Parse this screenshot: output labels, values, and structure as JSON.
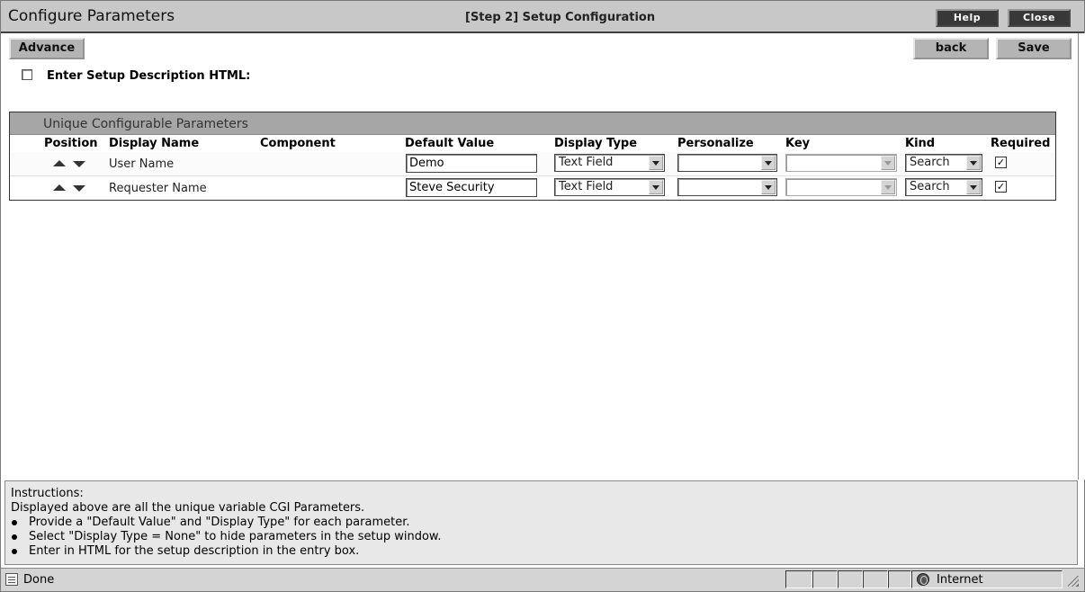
{
  "window": {
    "title": "Configure Parameters",
    "step_title": "[Step 2] Setup Configuration",
    "help_label": "Help",
    "close_label": "Close"
  },
  "toolbar": {
    "advance_label": "Advance",
    "back_label": "back",
    "save_label": "Save"
  },
  "description": {
    "checkbox_checked": false,
    "label": "Enter Setup Description HTML:"
  },
  "params": {
    "section_title": "Unique Configurable Parameters",
    "columns": [
      "Position",
      "Display Name",
      "Component",
      "Default Value",
      "Display Type",
      "Personalize",
      "Key",
      "Kind",
      "Required"
    ],
    "rows": [
      {
        "display_name": "User Name",
        "component": "",
        "default_value": "Demo",
        "display_type": "Text Field",
        "personalize": "",
        "key": "",
        "kind": "Search",
        "required": true
      },
      {
        "display_name": "Requester Name",
        "component": "",
        "default_value": "Steve Security",
        "display_type": "Text Field",
        "personalize": "",
        "key": "",
        "kind": "Search",
        "required": true
      }
    ]
  },
  "instructions": {
    "title": "Instructions:",
    "intro": "Displayed above are all the unique variable CGI Parameters.",
    "items": [
      "Provide a \"Default Value\" and \"Display Type\" for each parameter.",
      "Select \"Display Type = None\" to hide parameters in the setup window.",
      "Enter in HTML for the setup description in the entry box."
    ]
  },
  "statusbar": {
    "status_text": "Done",
    "zone_text": "Internet",
    "icons": [
      "page-icon",
      "internet-zone-icon",
      "resize-grip-icon"
    ]
  }
}
